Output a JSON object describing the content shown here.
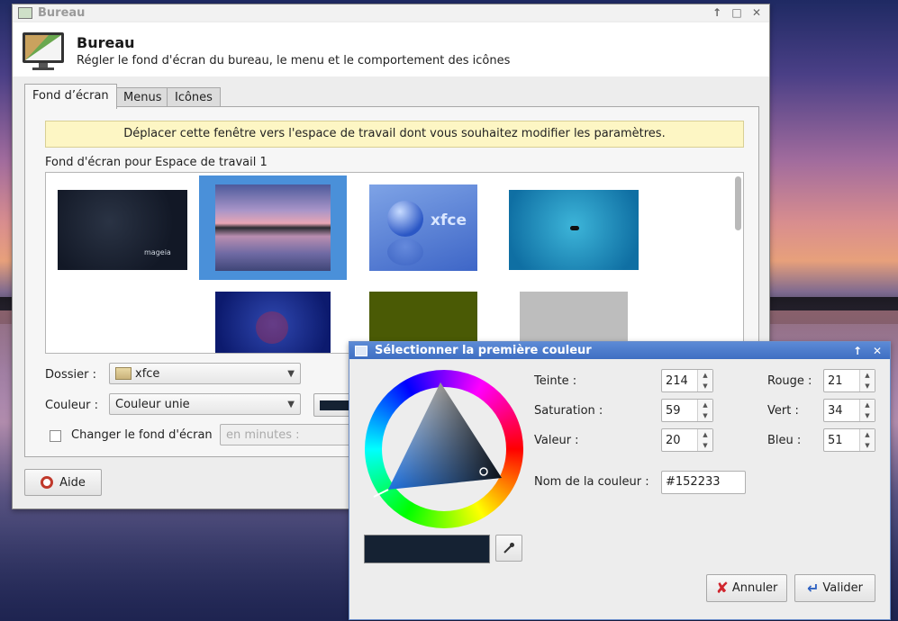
{
  "colors": {
    "selected": "#152233",
    "infobar_bg": "#fdf6c4",
    "dialog_title_bg": "#4a7bcd",
    "wall_selection": "#4a90d9"
  },
  "bureau": {
    "window_title": "Bureau",
    "header_title": "Bureau",
    "header_subtitle": "Régler le fond d'écran du bureau, le menu et le comportement des icônes",
    "icons": {
      "app": "monitor-icon",
      "restore": "arrow-up-icon",
      "maximize": "square-icon",
      "close": "close-icon"
    },
    "tabs": [
      {
        "label": "Fond d’écran",
        "active": true
      },
      {
        "label": "Menus",
        "active": false
      },
      {
        "label": "Icônes",
        "active": false
      }
    ],
    "info_message": "Déplacer cette fenêtre vers l'espace de travail dont vous souhaitez modifier les paramètres.",
    "wallpaper_label": "Fond d'écran pour Espace de travail 1",
    "thumb_texts": {
      "mageia": "mageia",
      "xfce": "xfce"
    },
    "folder": {
      "label": "Dossier :",
      "value": "xfce",
      "icon": "folder-icon"
    },
    "color": {
      "label": "Couleur :",
      "value": "Couleur unie"
    },
    "change": {
      "label": "Changer le fond d'écran",
      "checked": false,
      "interval_placeholder": "en minutes :"
    },
    "help_button": "Aide"
  },
  "color_dialog": {
    "title": "Sélectionner la première couleur",
    "hsv": [
      {
        "label": "Teinte :",
        "value": "214"
      },
      {
        "label": "Saturation :",
        "value": "59"
      },
      {
        "label": "Valeur :",
        "value": "20"
      }
    ],
    "rgb": [
      {
        "label": "Rouge :",
        "value": "21"
      },
      {
        "label": "Vert :",
        "value": "34"
      },
      {
        "label": "Bleu :",
        "value": "51"
      }
    ],
    "name_label": "Nom de la couleur :",
    "name_value": "#152233",
    "cancel_button": "Annuler",
    "ok_button": "Valider"
  }
}
